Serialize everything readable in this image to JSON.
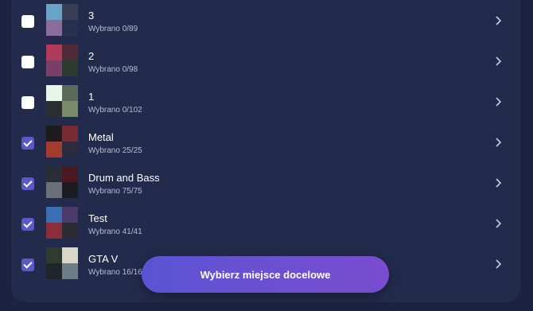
{
  "playlists": [
    {
      "title": "3",
      "selected_text": "Wybrano 0/89",
      "checked": false,
      "thumbs": [
        "#6aa3c8",
        "#3b3f55",
        "#8a6d9a",
        "#25314f"
      ]
    },
    {
      "title": "2",
      "selected_text": "Wybrano 0/98",
      "checked": false,
      "thumbs": [
        "#b03a5b",
        "#4f2b3a",
        "#7b3d6a",
        "#2e3a2d"
      ]
    },
    {
      "title": "1",
      "selected_text": "Wybrano 0/102",
      "checked": false,
      "thumbs": [
        "#e9f5ea",
        "#5c6a5a",
        "#2b2f34",
        "#7c8a6c"
      ]
    },
    {
      "title": "Metal",
      "selected_text": "Wybrano 25/25",
      "checked": true,
      "thumbs": [
        "#1d1d1f",
        "#7a2a33",
        "#a33c2e",
        "#2a2c3e"
      ]
    },
    {
      "title": "Drum and Bass",
      "selected_text": "Wybrano 75/75",
      "checked": true,
      "thumbs": [
        "#2a2d34",
        "#4a1820",
        "#6a6f7a",
        "#1a1c22"
      ]
    },
    {
      "title": "Test",
      "selected_text": "Wybrano 41/41",
      "checked": true,
      "thumbs": [
        "#3b6fb3",
        "#4a3a6a",
        "#8a2f3a",
        "#2d2a35"
      ]
    },
    {
      "title": "GTA V",
      "selected_text": "Wybrano 16/16",
      "checked": true,
      "thumbs": [
        "#2f3b2e",
        "#d9d6c8",
        "#1e2629",
        "#6c7d88"
      ]
    }
  ],
  "cta_label": "Wybierz miejsce docelowe",
  "colors": {
    "background": "#1b2340",
    "panel": "#232b4c",
    "accent": "#5c58c9"
  }
}
